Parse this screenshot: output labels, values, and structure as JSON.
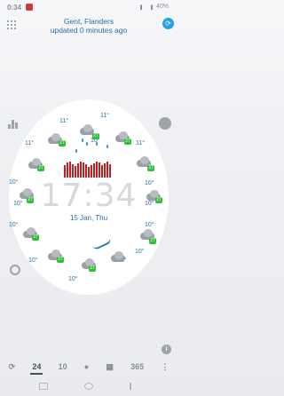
{
  "status": {
    "time": "0:34",
    "battery": "40%"
  },
  "header": {
    "city": "Gent, Flanders",
    "updated": "updated 0 minutes ago"
  },
  "clock": {
    "time": "17:34",
    "date": "15 Jan, Thu"
  },
  "temps": {
    "t1": "11°",
    "t2": "11°",
    "t3": "11°",
    "t4": "11°",
    "t5": "10°",
    "t6": "10°",
    "t7": "10°",
    "t8": "10°",
    "t9": "10°",
    "t10": "10°",
    "t11": "10°",
    "t12": "10°",
    "t13": "10°",
    "t14": "10°",
    "t15": "10°"
  },
  "badge": "27",
  "bottom_bar": {
    "b24": "24",
    "b10": "10",
    "b365": "365"
  },
  "colors": {
    "accent": "#2b6ea4",
    "badge": "#2fbf3a",
    "chart": "#c41e1e",
    "refresh": "#26a0e2"
  }
}
